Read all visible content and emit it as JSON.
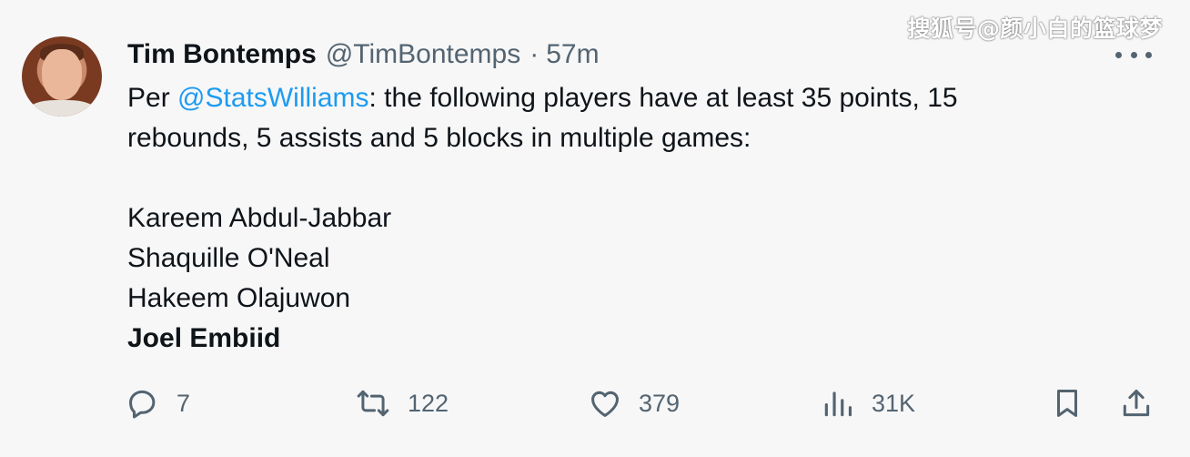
{
  "watermark": "搜狐号@颜小白的篮球梦",
  "tweet": {
    "author_name": "Tim Bontemps",
    "handle": "@TimBontemps",
    "separator": "·",
    "time": "57m",
    "text_prefix": "Per ",
    "mention": "@StatsWilliams",
    "text_line1_rest": ": the following players have at least 35 points, 15",
    "text_line2": "rebounds, 5 assists and 5 blocks in multiple games:",
    "players": [
      "Kareem Abdul-Jabbar",
      "Shaquille O'Neal",
      "Hakeem Olajuwon"
    ],
    "highlighted_player": "Joel Embiid"
  },
  "actions": {
    "replies": "7",
    "retweets": "122",
    "likes": "379",
    "views": "31K"
  },
  "icons": [
    "reply-icon",
    "retweet-icon",
    "like-icon",
    "views-icon",
    "bookmark-icon",
    "share-icon",
    "more-icon"
  ],
  "colors": {
    "mention": "#1d9bf0",
    "secondary_text": "#536471",
    "text": "#0f1419"
  }
}
